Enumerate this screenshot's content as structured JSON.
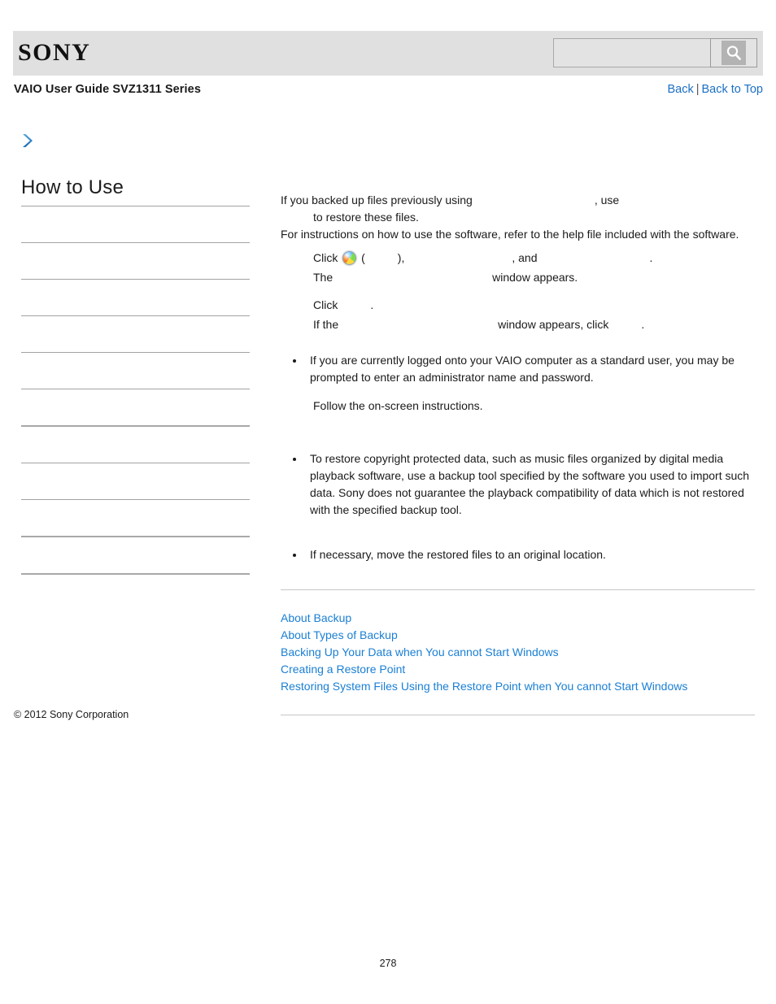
{
  "header": {
    "logo_text": "SONY",
    "search": {
      "value": "",
      "placeholder": "",
      "button_icon": "search-icon"
    }
  },
  "subheader": {
    "guide_title": "VAIO User Guide SVZ1311 Series",
    "back_label": "Back",
    "separator": "|",
    "back_to_top_label": "Back to Top"
  },
  "breadcrumb": {
    "chevron_icon": "chevron-right-icon"
  },
  "sidebar": {
    "heading": "How to Use",
    "items": [
      {
        "label": ""
      },
      {
        "label": ""
      },
      {
        "label": ""
      },
      {
        "label": ""
      },
      {
        "label": ""
      },
      {
        "label": ""
      },
      {
        "label": ""
      },
      {
        "label": ""
      },
      {
        "label": ""
      },
      {
        "label": ""
      }
    ]
  },
  "content": {
    "intro_line1_a": "If you backed up files previously using",
    "intro_line1_b": ", use",
    "intro_line2": "to restore these files.",
    "intro_line3": "For instructions on how to use the software, refer to the help file included with the software.",
    "step1_click": "Click",
    "step1_paren_open": "(",
    "step1_paren_close": "),",
    "step1_and": ", and",
    "step1_period": ".",
    "step1_start_icon": "windows-start-orb-icon",
    "step2_the": "The",
    "step2_window_appears": "window appears.",
    "step3_click": "Click",
    "step3_period": ".",
    "step4_if_the": "If the",
    "step4_window_appears_click": "window appears, click",
    "step4_period": ".",
    "note_admin": "If you are currently logged onto your VAIO computer as a standard user, you may be prompted to enter an administrator name and password.",
    "follow_instructions": "Follow the on-screen instructions.",
    "note_copyright": "To restore copyright protected data, such as music files organized by digital media playback software, use a backup tool specified by the software you used to import such data. Sony does not guarantee the playback compatibility of data which is not restored with the specified backup tool.",
    "note_move": "If necessary, move the restored files to an original location."
  },
  "related_topics": [
    {
      "label": "About Backup"
    },
    {
      "label": "About Types of Backup"
    },
    {
      "label": "Backing Up Your Data when You cannot Start Windows"
    },
    {
      "label": "Creating a Restore Point"
    },
    {
      "label": "Restoring System Files Using the Restore Point when You cannot Start Windows"
    }
  ],
  "footer": {
    "copyright": "© 2012 Sony Corporation",
    "page_number": "278"
  },
  "colors": {
    "link": "#1a7fd4",
    "nav_link": "#1a6fc4",
    "header_band": "#e0e0e0",
    "rule": "#a2a2a2"
  }
}
